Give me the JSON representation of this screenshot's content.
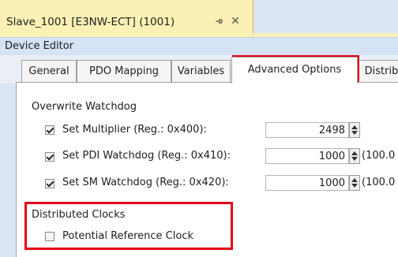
{
  "doc_tab": {
    "title": "Slave_1001 [E3NW-ECT] (1001)",
    "pin_icon": "pin-icon",
    "close_icon": "close-icon",
    "close_glyph": "✕"
  },
  "editor_header": {
    "title": "Device Editor"
  },
  "tabs": [
    {
      "label": "General"
    },
    {
      "label": "PDO Mapping"
    },
    {
      "label": "Variables"
    },
    {
      "label": "Advanced Options",
      "active": true
    },
    {
      "label": "Distrib"
    }
  ],
  "watchdog": {
    "group_label": "Overwrite Watchdog",
    "rows": [
      {
        "label": "Set Multiplier (Reg.: 0x400):",
        "checked": true,
        "value": "2498",
        "suffix": ""
      },
      {
        "label": "Set PDI Watchdog (Reg.: 0x410):",
        "checked": true,
        "value": "1000",
        "suffix": "(100.0"
      },
      {
        "label": "Set SM Watchdog (Reg.: 0x420):",
        "checked": true,
        "value": "1000",
        "suffix": "(100.0"
      }
    ]
  },
  "clocks": {
    "group_label": "Distributed Clocks",
    "potential_ref_label": "Potential Reference Clock",
    "potential_ref_checked": false
  },
  "colors": {
    "highlight": "#e60012",
    "doc_tab_bg": "#fbf1b4"
  }
}
